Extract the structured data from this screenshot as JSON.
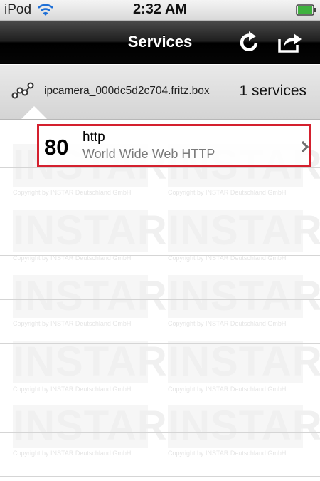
{
  "status_bar": {
    "carrier": "iPod",
    "time": "2:32 AM"
  },
  "nav": {
    "title": "Services",
    "refresh_icon": "refresh-icon",
    "share_icon": "share-icon"
  },
  "host": {
    "name": "ipcamera_000dc5d2c704.fritz.box",
    "count": "1 services",
    "icon": "network-nodes-icon"
  },
  "services": [
    {
      "port": "80",
      "protocol": "http",
      "description": "World Wide Web HTTP"
    }
  ],
  "watermark": {
    "text": "INSTAR",
    "copyright": "Copyright by INSTAR Deutschland GmbH"
  },
  "colors": {
    "highlight_border": "#d4202e",
    "nav_bar": "#000000"
  }
}
